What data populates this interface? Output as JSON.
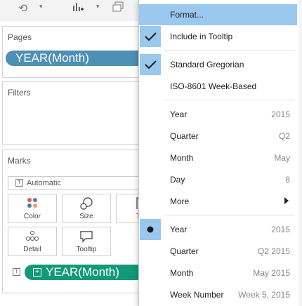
{
  "pages": {
    "title": "Pages",
    "pill": "YEAR(Month)"
  },
  "filters": {
    "title": "Filters"
  },
  "marks": {
    "title": "Marks",
    "type_select": "Automatic",
    "buttons": [
      {
        "label": "Color",
        "icon": "color-dots-icon"
      },
      {
        "label": "Size",
        "icon": "size-icon"
      },
      {
        "label": "T",
        "icon": "text-icon"
      },
      {
        "label": "Detail",
        "icon": "detail-dots-icon"
      },
      {
        "label": "Tooltip",
        "icon": "tooltip-icon"
      }
    ],
    "field_pill": "YEAR(Month)"
  },
  "menu": {
    "format": "Format...",
    "include_tooltip": "Include in Tooltip",
    "standard_gregorian": "Standard Gregorian",
    "iso_week": "ISO-8601 Week-Based",
    "discrete": [
      {
        "label": "Year",
        "value": "2015"
      },
      {
        "label": "Quarter",
        "value": "Q2"
      },
      {
        "label": "Month",
        "value": "May"
      },
      {
        "label": "Day",
        "value": "8"
      },
      {
        "label": "More",
        "value": ""
      }
    ],
    "continuous": [
      {
        "label": "Year",
        "value": "2015"
      },
      {
        "label": "Quarter",
        "value": "Q2 2015"
      },
      {
        "label": "Month",
        "value": "May 2015"
      },
      {
        "label": "Week Number",
        "value": "Week 5, 2015"
      }
    ]
  },
  "colors": {
    "highlight": "#9ac8ef",
    "pages_pill": "#4e8fb5",
    "marks_pill": "#119a77"
  }
}
